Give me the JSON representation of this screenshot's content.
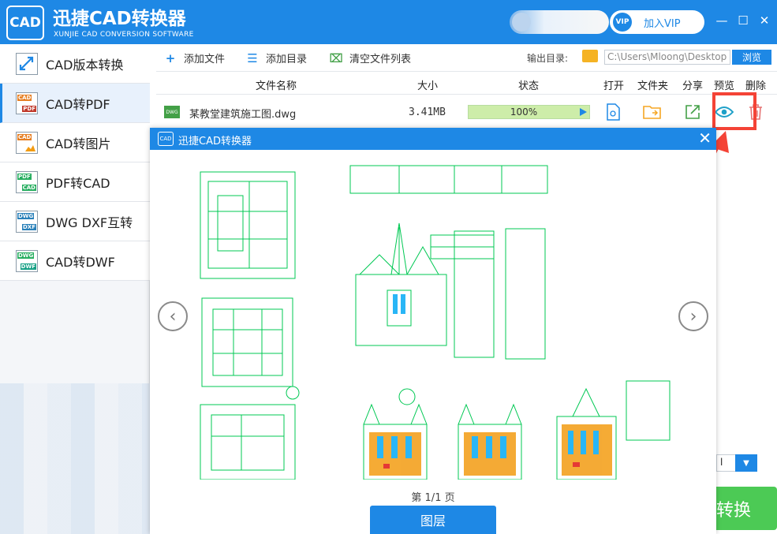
{
  "app": {
    "logo_text": "CAD",
    "title": "迅捷CAD转换器",
    "subtitle": "XUNJIE CAD CONVERSION SOFTWARE",
    "vip_badge": "VIP",
    "vip_label": "加入VIP",
    "window_buttons": [
      "minimize-icon",
      "maximize-icon",
      "close-icon"
    ]
  },
  "sidebar": {
    "items": [
      {
        "label": "CAD版本转换",
        "icon": "cad-version-icon",
        "tag1": "",
        "tag2": ""
      },
      {
        "label": "CAD转PDF",
        "icon": "cad-to-pdf-icon",
        "tag1": "CAD",
        "tag2": "PDF",
        "active": true
      },
      {
        "label": "CAD转图片",
        "icon": "cad-to-image-icon",
        "tag1": "CAD",
        "tag2": ""
      },
      {
        "label": "PDF转CAD",
        "icon": "pdf-to-cad-icon",
        "tag1": "PDF",
        "tag2": "CAD"
      },
      {
        "label": "DWG DXF互转",
        "icon": "dwg-dxf-icon",
        "tag1": "DWG",
        "tag2": "DXF"
      },
      {
        "label": "CAD转DWF",
        "icon": "cad-to-dwf-icon",
        "tag1": "DWG",
        "tag2": "DWF"
      }
    ]
  },
  "toolbar": {
    "add_file": "添加文件",
    "add_dir": "添加目录",
    "clear_list": "清空文件列表",
    "output_label": "输出目录:",
    "output_path": "C:\\Users\\Mloong\\Desktop",
    "browse": "浏览"
  },
  "table": {
    "headers": {
      "name": "文件名称",
      "size": "大小",
      "status": "状态",
      "open": "打开",
      "folder": "文件夹",
      "share": "分享",
      "preview": "预览",
      "delete": "删除"
    },
    "rows": [
      {
        "file_icon": "DWG",
        "name": "某教堂建筑施工图.dwg",
        "size": "3.41MB",
        "progress_text": "100%",
        "progress": 1.0
      }
    ]
  },
  "modal": {
    "logo_text": "CAD",
    "title": "迅捷CAD转换器",
    "close": "✕",
    "prev": "‹",
    "next": "›",
    "page_indicator": "第 1/1 页",
    "layer_button": "图层"
  },
  "behind": {
    "convert_label": "转换"
  },
  "colors": {
    "brand_blue": "#1e88e5",
    "highlight_red": "#f44336",
    "convert_green": "#4cca55",
    "drawing_green": "#00c853"
  }
}
